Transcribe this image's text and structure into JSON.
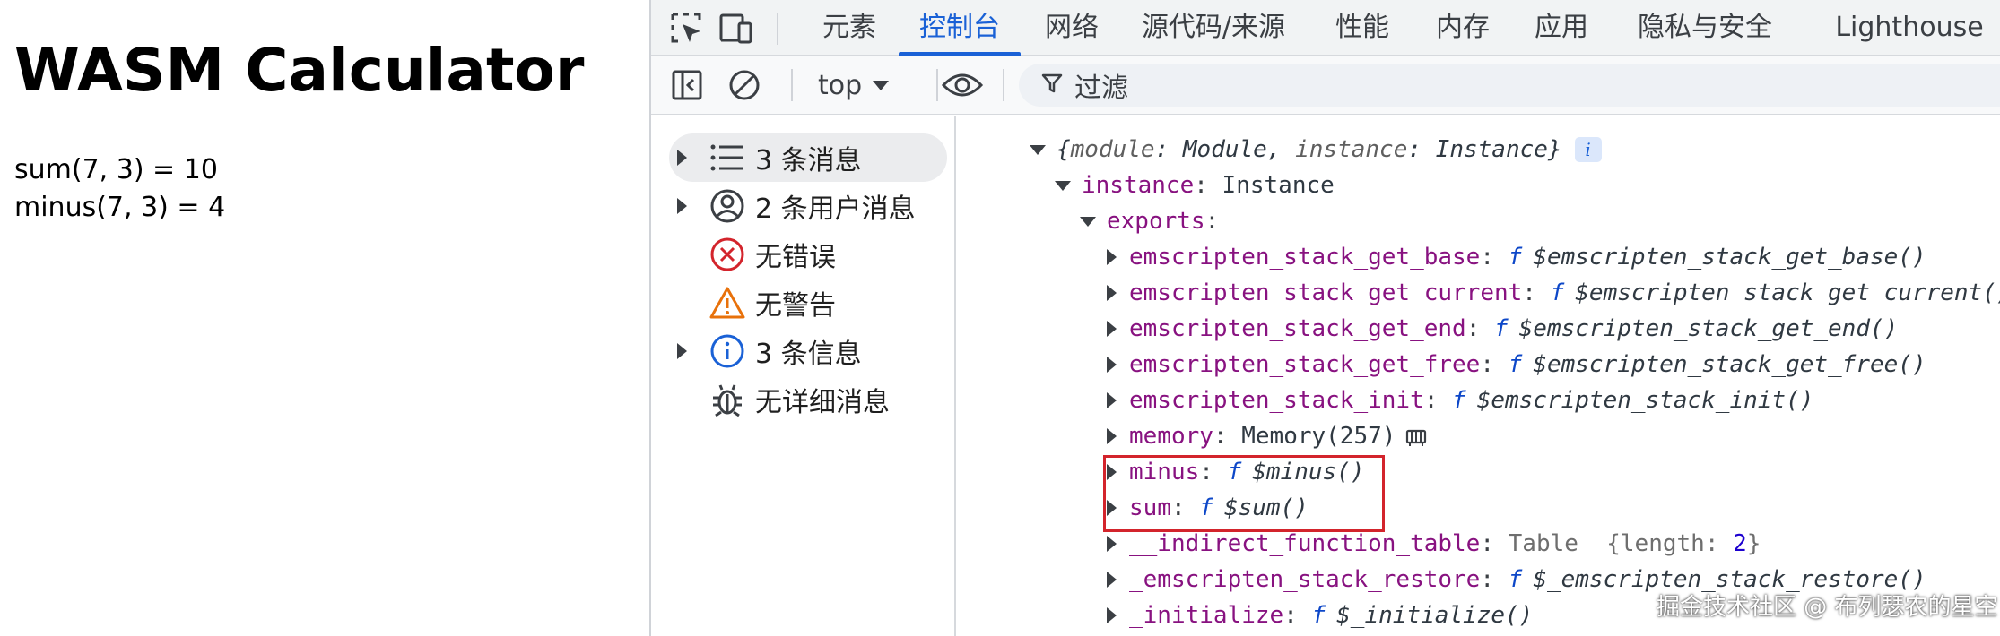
{
  "page": {
    "title": "WASM Calculator",
    "lines": [
      "sum(7, 3) = 10",
      "minus(7, 3) = 4"
    ]
  },
  "devtools": {
    "tabs": [
      {
        "label": "元素",
        "active": false
      },
      {
        "label": "控制台",
        "active": true
      },
      {
        "label": "网络",
        "active": false
      },
      {
        "label": "源代码/来源",
        "active": false
      },
      {
        "label": "性能",
        "active": false
      },
      {
        "label": "内存",
        "active": false
      },
      {
        "label": "应用",
        "active": false
      },
      {
        "label": "隐私与安全",
        "active": false
      },
      {
        "label": "Lighthouse",
        "active": false
      }
    ],
    "toolbar": {
      "context": "top",
      "filter_placeholder": "过滤"
    },
    "sidebar": [
      {
        "label": "3 条消息",
        "icon": "list-icon",
        "expandable": true,
        "selected": true
      },
      {
        "label": "2 条用户消息",
        "icon": "user-icon",
        "expandable": true,
        "selected": false
      },
      {
        "label": "无错误",
        "icon": "error-icon",
        "expandable": false,
        "selected": false
      },
      {
        "label": "无警告",
        "icon": "warning-icon",
        "expandable": false,
        "selected": false
      },
      {
        "label": "3 条信息",
        "icon": "info-icon",
        "expandable": true,
        "selected": false
      },
      {
        "label": "无详细消息",
        "icon": "bug-icon",
        "expandable": false,
        "selected": false
      }
    ],
    "console": {
      "summary": {
        "k1": "module",
        "v1": "Module",
        "k2": "instance",
        "v2": "Instance",
        "badge": "i"
      },
      "instance": {
        "key": "instance",
        "value": "Instance"
      },
      "exports_key": "exports",
      "exports": [
        {
          "key": "emscripten_stack_get_base",
          "value": "$emscripten_stack_get_base()"
        },
        {
          "key": "emscripten_stack_get_current",
          "value": "$emscripten_stack_get_current()"
        },
        {
          "key": "emscripten_stack_get_end",
          "value": "$emscripten_stack_get_end()"
        },
        {
          "key": "emscripten_stack_get_free",
          "value": "$emscripten_stack_get_free()"
        },
        {
          "key": "emscripten_stack_init",
          "value": "$emscripten_stack_init()"
        }
      ],
      "memory": {
        "key": "memory",
        "value": "Memory(257)"
      },
      "minus": {
        "key": "minus",
        "value": "$minus()"
      },
      "sum": {
        "key": "sum",
        "value": "$sum()"
      },
      "table": {
        "key": "__indirect_function_table",
        "type": "Table",
        "length_key": "length",
        "length": "2"
      },
      "restore": {
        "key": "_emscripten_stack_restore",
        "value": "$_emscripten_stack_restore()"
      },
      "initialize": {
        "key": "_initialize",
        "value": "$_initialize()"
      },
      "f": "f"
    }
  },
  "watermark": "掘金技术社区 @ 布列瑟农的星空",
  "colors": {
    "accent": "#1a61d6",
    "property_key": "#881280",
    "highlight": "#d3242c"
  }
}
